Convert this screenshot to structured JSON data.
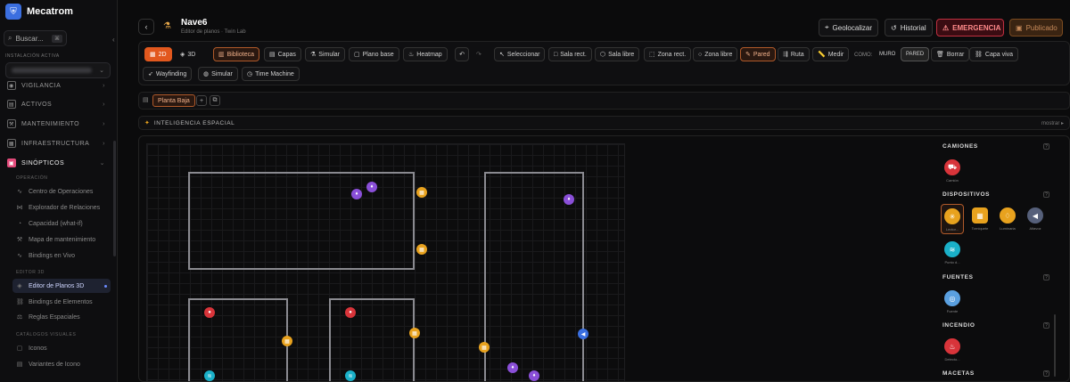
{
  "app": {
    "name": "Mecatrom"
  },
  "search": {
    "placeholder": "Buscar...",
    "shortcut": "⌘"
  },
  "installation": {
    "label": "INSTALACIÓN ACTIVA"
  },
  "nav": {
    "sections": [
      {
        "label": "VIGILANCIA",
        "icon": "eye-icon"
      },
      {
        "label": "ACTIVOS",
        "icon": "box-icon"
      },
      {
        "label": "MANTENIMIENTO",
        "icon": "wrench-icon"
      },
      {
        "label": "INFRAESTRUCTURA",
        "icon": "building-icon"
      },
      {
        "label": "SINÓPTICOS",
        "icon": "grid-icon"
      }
    ],
    "group_operacion": "OPERACIÓN",
    "operacion": [
      "Centro de Operaciones",
      "Explorador de Relaciones",
      "Capacidad (what-if)",
      "Mapa de mantenimiento",
      "Bindings en Vivo"
    ],
    "group_editor": "EDITOR 3D",
    "editor": [
      "Editor de Planos 3D",
      "Bindings de Elementos",
      "Reglas Espaciales"
    ],
    "group_catalogos": "CATÁLOGOS VISUALES",
    "catalogos": [
      "Iconos",
      "Variantes de Icono"
    ]
  },
  "header": {
    "title": "Nave6",
    "subtitle": "Editor de planos · Twin Lab",
    "geolocalizar": "Geolocalizar",
    "historial": "Historial",
    "emergencia": "EMERGENCIA",
    "publicado": "Publicado"
  },
  "toolbar": {
    "mode_2d": "2D",
    "mode_3d": "3D",
    "biblioteca": "Biblioteca",
    "capas": "Capas",
    "simular": "Simular",
    "plano_base": "Plano base",
    "heatmap": "Heatmap",
    "seleccionar": "Seleccionar",
    "sala_rect": "Sala rect.",
    "sala_libre": "Sala libre",
    "zona_rect": "Zona rect.",
    "zona_libre": "Zona libre",
    "pared": "Pared",
    "ruta": "Ruta",
    "medir": "Medir",
    "como": "COMO:",
    "muro": "MURO",
    "pared_opt": "PARED",
    "borrar": "Borrar",
    "capa_viva": "Capa viva",
    "wayfinding": "Wayfinding",
    "simular2": "Simular",
    "time_machine": "Time Machine"
  },
  "floor": {
    "tab": "Planta Baja"
  },
  "intel": {
    "title": "INTELIGENCIA ESPACIAL",
    "action": "mostrar ▸"
  },
  "palette": {
    "camiones": {
      "title": "CAMIONES",
      "items": [
        {
          "name": "Camión",
          "color": "#d8343a"
        }
      ]
    },
    "dispositivos": {
      "title": "DISPOSITIVOS",
      "items": [
        {
          "name": "Lector...",
          "color": "#e8a21e"
        },
        {
          "name": "Torniquete",
          "color": "#e8a21e"
        },
        {
          "name": "Luminaria",
          "color": "#e8a21e"
        },
        {
          "name": "Altavoz",
          "color": "#56607a"
        },
        {
          "name": "Punto d...",
          "color": "#1ab0c8"
        }
      ]
    },
    "fuentes": {
      "title": "FUENTES",
      "items": [
        {
          "name": "Fuente",
          "color": "#5aa0e0"
        }
      ]
    },
    "incendio": {
      "title": "INCENDIO",
      "items": [
        {
          "name": "Detecto...",
          "color": "#d8343a"
        }
      ]
    },
    "macetas": {
      "title": "MACETAS"
    }
  },
  "colors": {
    "accent": "#e2581e",
    "emergency": "#c03040",
    "active_nav": "#e24a7a"
  }
}
